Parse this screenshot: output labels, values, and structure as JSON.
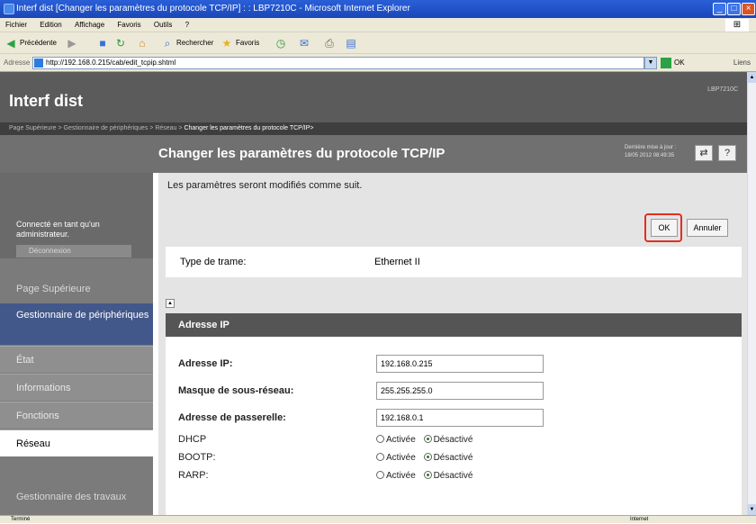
{
  "window": {
    "title": "Interf dist [Changer les paramètres du protocole TCP/IP] : : LBP7210C - Microsoft Internet Explorer"
  },
  "menu": [
    "Fichier",
    "Edition",
    "Affichage",
    "Favoris",
    "Outils",
    "?"
  ],
  "toolbar": {
    "back": "Précédente",
    "search": "Rechercher",
    "favorites": "Favoris"
  },
  "address": {
    "label": "Adresse",
    "url": "http://192.168.0.215/cab/edit_tcpip.shtml",
    "go": "OK",
    "links": "Liens"
  },
  "header": {
    "app_title": "Interf dist",
    "model": "LBP7210C"
  },
  "breadcrumb": {
    "items": [
      "Page Supérieure >",
      "Gestionnaire de périphériques >",
      "Réseau >"
    ],
    "current": "Changer les paramètres du protocole TCP/IP>"
  },
  "page": {
    "title": "Changer les paramètres du protocole TCP/IP",
    "last_update": "Dernière mise à jour : 18/05 2012 08:49:35"
  },
  "sidebar": {
    "login_text": "Connecté en tant qu'un administrateur.",
    "logout": "Déconnexion",
    "top": "Page Supérieure",
    "devmgr": "Gestionnaire de périphériques",
    "items": [
      "État",
      "Informations",
      "Fonctions",
      "Réseau"
    ],
    "jobs": "Gestionnaire des travaux"
  },
  "main": {
    "intro": "Les paramètres seront modifiés comme suit.",
    "ok": "OK",
    "cancel": "Annuler",
    "frame_label": "Type de trame:",
    "frame_value": "Ethernet II",
    "section": "Adresse IP",
    "fields": [
      {
        "label": "Adresse IP:",
        "value": "192.168.0.215"
      },
      {
        "label": "Masque de sous-réseau:",
        "value": "255.255.255.0"
      },
      {
        "label": "Adresse de passerelle:",
        "value": "192.168.0.1"
      }
    ],
    "options": [
      {
        "label": "DHCP",
        "on": "Activée",
        "off": "Désactivé",
        "selected": "off"
      },
      {
        "label": "BOOTP:",
        "on": "Activée",
        "off": "Désactivé",
        "selected": "off"
      },
      {
        "label": "RARP:",
        "on": "Activée",
        "off": "Désactivé",
        "selected": "off"
      }
    ]
  },
  "status": {
    "left": "Terminé",
    "zone": "Internet"
  }
}
